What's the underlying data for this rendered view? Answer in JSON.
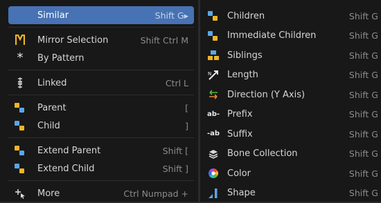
{
  "left_menu": {
    "similar": {
      "label": "Similar",
      "shortcut": "Shift G▸"
    },
    "mirror_selection": {
      "label": "Mirror Selection",
      "shortcut": "Shift Ctrl M"
    },
    "by_pattern": {
      "label": "By Pattern",
      "shortcut": ""
    },
    "linked": {
      "label": "Linked",
      "shortcut": "Ctrl L"
    },
    "parent": {
      "label": "Parent",
      "shortcut": "["
    },
    "child": {
      "label": "Child",
      "shortcut": "]"
    },
    "extend_parent": {
      "label": "Extend Parent",
      "shortcut": "Shift ["
    },
    "extend_child": {
      "label": "Extend Child",
      "shortcut": "Shift ]"
    },
    "more": {
      "label": "More",
      "shortcut": "Ctrl Numpad +"
    }
  },
  "right_menu": {
    "items": [
      {
        "label": "Children",
        "shortcut": "Shift G"
      },
      {
        "label": "Immediate Children",
        "shortcut": "Shift G"
      },
      {
        "label": "Siblings",
        "shortcut": "Shift G"
      },
      {
        "label": "Length",
        "shortcut": "Shift G"
      },
      {
        "label": "Direction (Y Axis)",
        "shortcut": "Shift G"
      },
      {
        "label": "Prefix",
        "shortcut": "Shift G"
      },
      {
        "label": "Suffix",
        "shortcut": "Shift G"
      },
      {
        "label": "Bone Collection",
        "shortcut": "Shift G"
      },
      {
        "label": "Color",
        "shortcut": "Shift G"
      },
      {
        "label": "Shape",
        "shortcut": "Shift G"
      }
    ],
    "prefix_icon_text": "ab-",
    "suffix_icon_text": "-ab"
  },
  "colors": {
    "highlight": "#4772b3",
    "menu_bg": "#181818",
    "text": "#d6d6d6",
    "shortcut": "#8c8c8c",
    "bone_blue": "#5aa6e8",
    "bone_yellow": "#f0b429",
    "direction_green": "#4fbf3a",
    "direction_orange": "#e7873a"
  }
}
